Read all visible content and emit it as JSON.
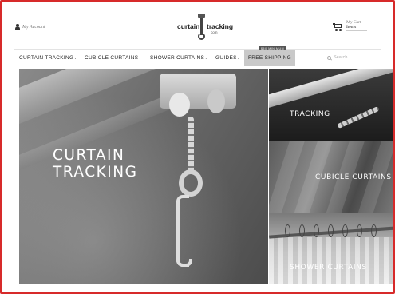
{
  "header": {
    "account_label": "My Account",
    "logo": {
      "left": "curtain",
      "right": "tracking",
      "sub": "com"
    },
    "cart": {
      "label": "My Cart",
      "items": "Items"
    }
  },
  "nav": {
    "items": [
      {
        "label": "Curtain Tracking"
      },
      {
        "label": "Cubicle Curtains"
      },
      {
        "label": "Shower Curtains"
      },
      {
        "label": "Guides"
      }
    ],
    "free_shipping": {
      "badge": "$50 MINIMUM",
      "label": "FREE SHIPPING"
    },
    "search_placeholder": "Search..."
  },
  "hero": {
    "title_line1": "CURTAIN",
    "title_line2": "TRACKING"
  },
  "tiles": [
    {
      "label": "TRACKING"
    },
    {
      "label": "CUBICLE CURTAINS"
    },
    {
      "label": "SHOWER CURTAINS"
    }
  ],
  "colors": {
    "frame": "#d72a2a",
    "ship_bg": "#c9c9c9"
  }
}
